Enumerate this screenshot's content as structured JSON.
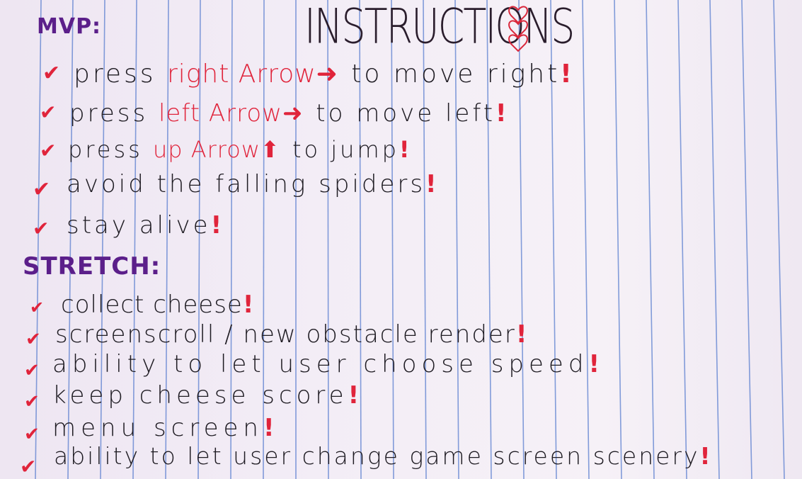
{
  "title": "INSTRUCTIONS",
  "mvp": {
    "heading": "MVP:",
    "items": [
      {
        "pre": "press",
        "key": "right Arrow",
        "post": "to move right"
      },
      {
        "pre": "press",
        "key": "left Arrow",
        "post": "to move left"
      },
      {
        "pre": "press",
        "key": "up Arrow",
        "post": "to jump"
      },
      {
        "pre": "avoid the falling spiders",
        "key": "",
        "post": ""
      },
      {
        "pre": "stay alive",
        "key": "",
        "post": ""
      }
    ]
  },
  "stretch": {
    "heading": "STRETCH:",
    "items": [
      "collect cheese",
      "screenscroll / new obstacle render",
      "ability to let user choose speed",
      "keep cheese score",
      "menu screen",
      "ability to let user change game screen scenery"
    ]
  },
  "check_glyph": "✔",
  "bang_glyph": "!",
  "colors": {
    "ink": "#1e1b22",
    "red": "#e0243b",
    "purple": "#5b1f8a",
    "rule": "#4f74c9"
  }
}
